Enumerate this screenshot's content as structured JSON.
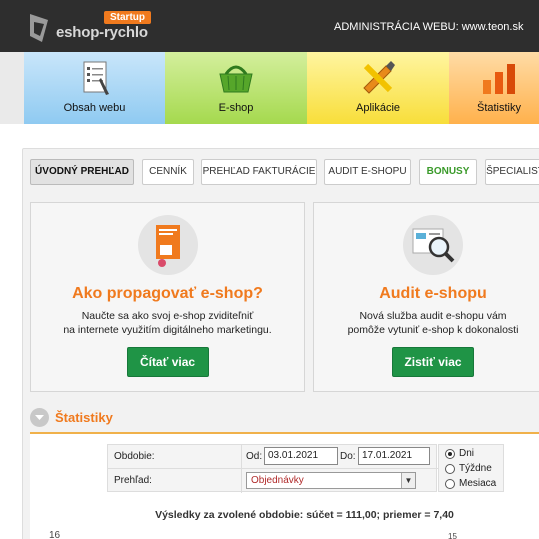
{
  "header": {
    "logo_text": "eshop-rychlo",
    "badge": "Startup",
    "admin": "ADMINISTRÁCIA WEBU: www.teon.sk"
  },
  "nav": {
    "items": [
      {
        "label": "Obsah webu",
        "icon": "document-list-icon"
      },
      {
        "label": "E-shop",
        "icon": "shopping-basket-icon"
      },
      {
        "label": "Aplikácie",
        "icon": "tools-icon"
      },
      {
        "label": "Štatistiky",
        "icon": "bar-chart-icon"
      }
    ]
  },
  "tabs": [
    {
      "label": "ÚVODNÝ PREHĽAD",
      "active": true
    },
    {
      "label": "CENNÍK"
    },
    {
      "label": "PREHĽAD FAKTURÁCIE"
    },
    {
      "label": "AUDIT E-SHOPU"
    },
    {
      "label": "BONUSY"
    },
    {
      "label": "ŠPECIALIST"
    }
  ],
  "cards": [
    {
      "title": "Ako propagovať e-shop?",
      "desc_line1": "Naučte sa ako svoj e-shop zviditeľniť",
      "desc_line2": "na internete využitím digitálneho marketingu.",
      "button": "Čítať viac"
    },
    {
      "title": "Audit e-shopu",
      "desc_line1": "Nová služba audit e-shopu vám",
      "desc_line2": "pomôže vytuniť e-shop k dokonalosti",
      "button": "Zistiť viac"
    }
  ],
  "stats": {
    "title": "Štatistiky",
    "period_label": "Obdobie:",
    "from_label": "Od:",
    "from_value": "03.01.2021",
    "to_label": "Do:",
    "to_value": "17.01.2021",
    "overview_label": "Prehľad:",
    "overview_selected": "Objednávky",
    "radios": [
      {
        "label": "Dni",
        "checked": true
      },
      {
        "label": "Týždne",
        "checked": false
      },
      {
        "label": "Mesiaca",
        "checked": false
      }
    ],
    "summary": "Výsledky za zvolené obdobie: súčet = 111,00;  priemer = 7,40",
    "axis_left": "16",
    "axis_right": "15"
  },
  "colors": {
    "accent": "#f07a1e",
    "button_green": "#1f9446",
    "header_bg": "#2e2e2e"
  }
}
